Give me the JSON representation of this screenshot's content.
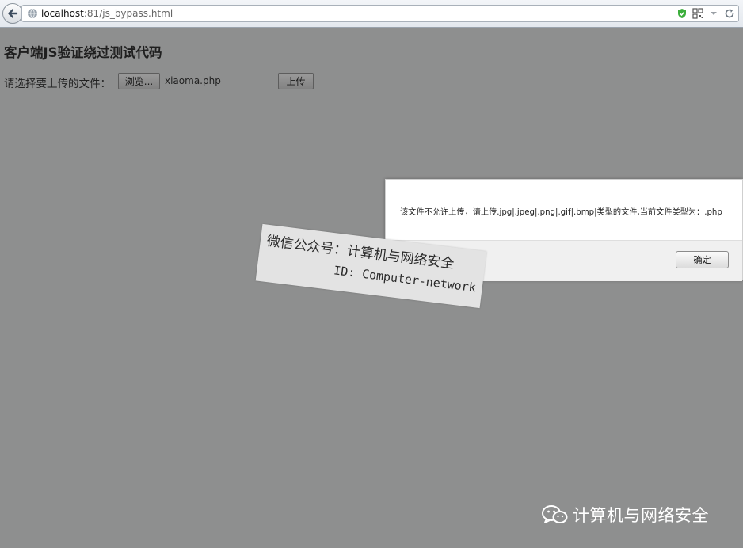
{
  "browser": {
    "url_host": "localhost",
    "url_rest": ":81/js_bypass.html"
  },
  "page": {
    "title": "客户端JS验证绕过测试代码",
    "upload_label": "请选择要上传的文件：",
    "browse_label": "浏览...",
    "file_name": "xiaoma.php",
    "upload_button": "上传"
  },
  "dialog": {
    "message": "该文件不允许上传，请上传.jpg|.jpeg|.png|.gif|.bmp|类型的文件,当前文件类型为：.php",
    "ok_label": "确定"
  },
  "watermark": {
    "line1": "微信公众号：计算机与网络安全",
    "line2": "ID: Computer-network"
  },
  "credit": {
    "text": "计算机与网络安全"
  },
  "colors": {
    "overlay": "#8e8f8f",
    "dialog_bg": "#ffffff",
    "dialog_footer": "#f0f0f0",
    "shield_green": "#3cae3c"
  }
}
